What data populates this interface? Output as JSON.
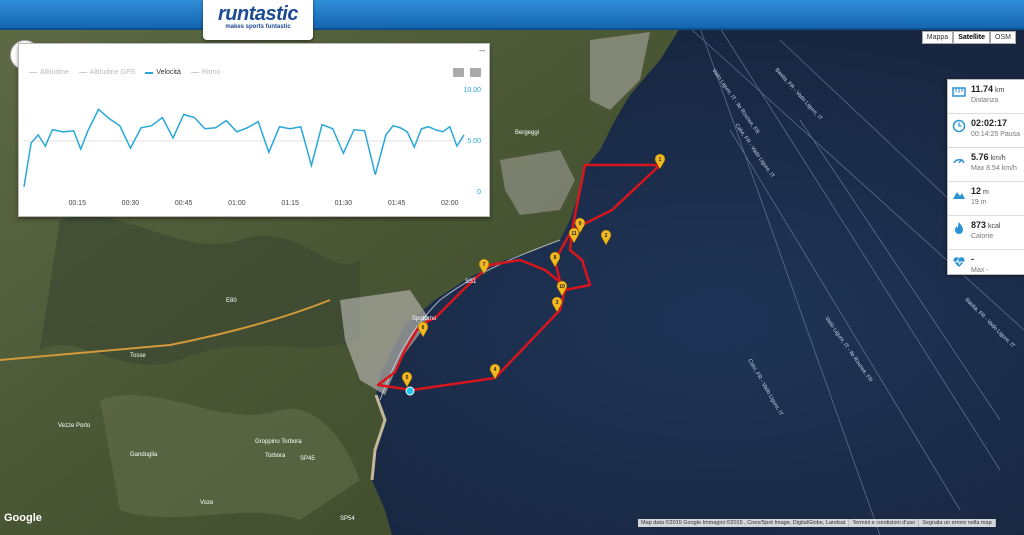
{
  "brand": {
    "name": "runtastic",
    "tagline": "makes sports funtastic"
  },
  "map_types": [
    "Mappa",
    "Satellite",
    "OSM"
  ],
  "map_type_active": "Satellite",
  "chart": {
    "legend": [
      "Altitudine",
      "Altitudine GPS",
      "Velocità",
      "Ritmo"
    ],
    "active_series": "Velocità",
    "chart_data": {
      "type": "line",
      "x_labels": [
        "00:15",
        "00:30",
        "00:45",
        "01:00",
        "01:15",
        "01:30",
        "01:45",
        "02:00"
      ],
      "y_ticks": [
        "10.00",
        "5.00",
        "0"
      ],
      "ylim": [
        0,
        10
      ],
      "series": [
        {
          "name": "Velocità",
          "x": [
            0,
            2,
            4,
            6,
            8,
            11,
            14,
            16,
            18,
            21,
            24,
            27,
            30,
            33,
            36,
            39,
            42,
            45,
            48,
            51,
            54,
            57,
            60,
            63,
            66,
            69,
            72,
            75,
            78,
            81,
            84,
            87,
            90,
            93,
            96,
            99,
            102,
            104,
            106,
            108,
            110,
            112,
            114,
            116,
            118,
            120,
            122,
            124
          ],
          "y": [
            0.5,
            4.8,
            5.6,
            4.5,
            6.1,
            5.9,
            6.0,
            4.2,
            6.0,
            8.1,
            7.2,
            6.5,
            4.3,
            6.3,
            6.5,
            7.3,
            5.3,
            7.6,
            7.3,
            6.2,
            6.3,
            7.0,
            5.9,
            6.3,
            6.9,
            3.9,
            6.4,
            6.2,
            6.4,
            2.6,
            6.6,
            6.2,
            3.8,
            6.1,
            6.0,
            1.7,
            5.6,
            6.5,
            6.3,
            5.9,
            4.4,
            6.2,
            6.4,
            6.1,
            5.9,
            6.4,
            4.5,
            5.6
          ]
        }
      ]
    }
  },
  "stats": [
    {
      "icon": "distance-icon",
      "value": "11.74",
      "unit": "km",
      "sub": "Distanza"
    },
    {
      "icon": "clock-icon",
      "value": "02:02:17",
      "unit": "",
      "sub": "00:14:25 Pausa"
    },
    {
      "icon": "speed-icon",
      "value": "5.76",
      "unit": "km/h",
      "sub": "Max 8.54 km/h"
    },
    {
      "icon": "elevation-icon",
      "value": "12",
      "unit": "m",
      "sub": "19 m"
    },
    {
      "icon": "calorie-icon",
      "value": "873",
      "unit": "kcal",
      "sub": "Calorie"
    },
    {
      "icon": "heart-rate-icon",
      "value": "-",
      "unit": "",
      "sub": "Max -"
    }
  ],
  "map_labels": [
    "Bergeggi",
    "Spotorno",
    "Tosse",
    "Vezze Porto",
    "Ganduglia",
    "Voze",
    "Groppino Torbora",
    "Torbora",
    "E80",
    "SS1",
    "SP45",
    "SP54"
  ],
  "route_labels": [
    "Vado Ligure, IT - Ile Rousse, FR",
    "Bastia, FR - Vado Ligure, IT",
    "Calvi, FR - Vado Ligure, IT",
    "Vado Ligure, IT - Ile Rousse, FR",
    "Calvi, FR - Vado Ligure, IT",
    "Bastia, FR - Vado Ligure, IT"
  ],
  "markers": [
    "1",
    "2",
    "3",
    "4",
    "5",
    "6",
    "7",
    "8",
    "9",
    "10",
    "11"
  ],
  "footer": [
    "Map data ©2015 Google Immagini ©2015 , Cnes/Spot Image, DigitalGlobe, Landsat",
    "Termini e condizioni d'uso",
    "Segnala un errore nella map"
  ],
  "google": "Google",
  "colors": {
    "route": "#d8151c",
    "sea": "#1b2a44",
    "land": "#4e5a38",
    "chart_line": "#2aa7d9",
    "marker": "#f2b822"
  }
}
